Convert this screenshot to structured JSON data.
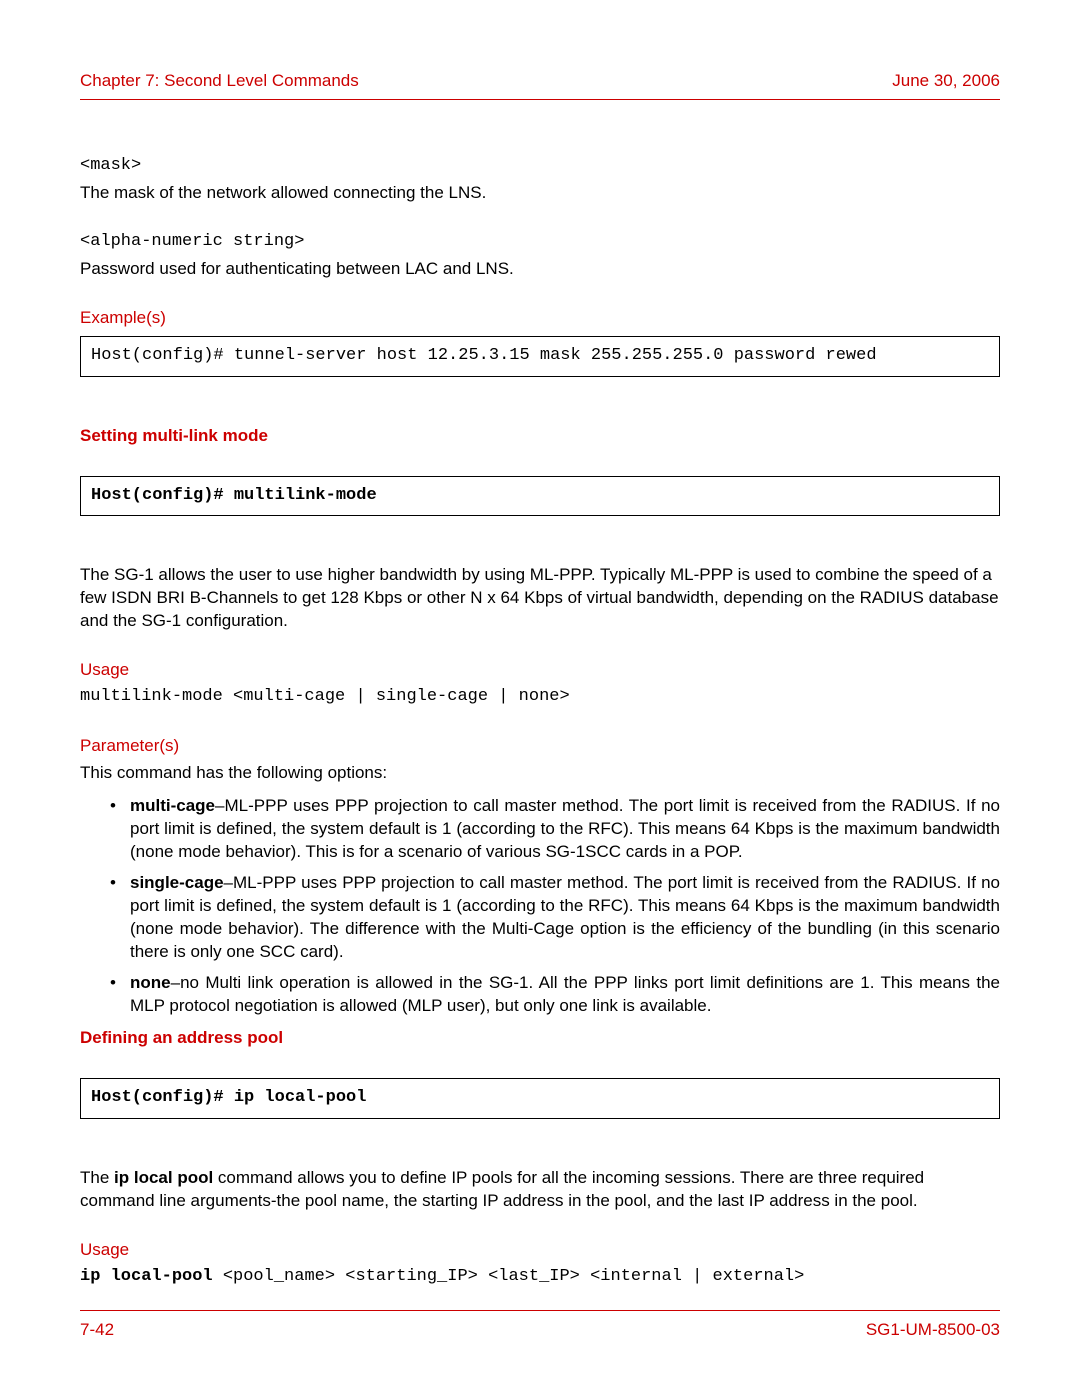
{
  "header": {
    "chapter": "Chapter 7: Second Level Commands",
    "date": "June 30, 2006"
  },
  "mask": {
    "tag": "<mask>",
    "desc": "The mask of the network allowed connecting the LNS."
  },
  "alpha": {
    "tag": "<alpha-numeric string>",
    "desc": "Password used for authenticating between LAC and LNS."
  },
  "examples": {
    "heading": "Example(s)",
    "box": "Host(config)# tunnel-server host 12.25.3.15 mask 255.255.255.0 password rewed"
  },
  "section1": {
    "heading": "Setting multi-link mode",
    "box": "Host(config)# multilink-mode",
    "paragraph": "The SG-1 allows the user to use higher bandwidth by using ML-PPP. Typically ML-PPP is used to combine the speed of a few ISDN BRI B-Channels to get 128 Kbps or other N x 64 Kbps of virtual bandwidth, depending on the RADIUS database and the SG-1 configuration.",
    "usage_heading": "Usage",
    "usage_line": "multilink-mode <multi-cage | single-cage | none>",
    "params_heading": "Parameter(s)",
    "params_intro": "This command has the following options:",
    "bullets": [
      {
        "bold": "multi-cage",
        "rest": "–ML-PPP uses PPP projection to call master method. The port limit is received from the RADIUS. If no port limit is defined, the system default is 1 (according to the RFC). This means 64 Kbps is the maximum bandwidth (none mode behavior). This is for a scenario of various SG-1SCC cards in a POP."
      },
      {
        "bold": "single-cage",
        "rest": "–ML-PPP uses PPP projection to call master method. The port limit is received from the RADIUS. If no port limit is defined, the system default is 1 (according to the RFC). This means 64 Kbps is the maximum bandwidth (none mode behavior). The difference with the Multi-Cage option is the efficiency of the bundling (in this scenario there is only one SCC card)."
      },
      {
        "bold": "none",
        "rest": "–no Multi link operation is allowed in the SG-1. All the PPP links port limit definitions are 1. This means the MLP protocol negotiation is allowed (MLP user), but only one link is available."
      }
    ]
  },
  "section2": {
    "heading": "Defining an address pool",
    "box": "Host(config)# ip local-pool",
    "para_prefix": "The ",
    "para_bold": "ip local pool",
    "para_suffix": " command allows you to define IP pools for all the incoming sessions. There are three required command line arguments-the pool name, the starting IP address in the pool, and the last IP address in the pool.",
    "usage_heading": "Usage",
    "usage_bold": "ip local-pool",
    "usage_rest": " <pool_name> <starting_IP> <last_IP> <internal | external>"
  },
  "footer": {
    "page": "7-42",
    "docid": "SG1-UM-8500-03"
  }
}
